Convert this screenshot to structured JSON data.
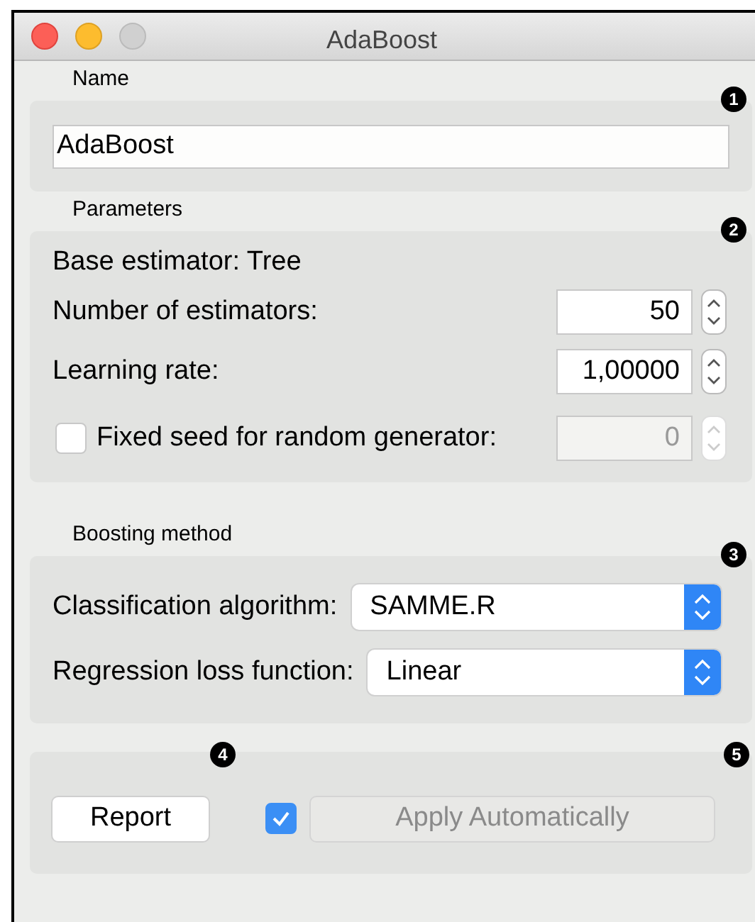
{
  "window": {
    "title": "AdaBoost"
  },
  "name_box": {
    "label": "Name",
    "callout": "1",
    "value": "AdaBoost"
  },
  "parameters": {
    "label": "Parameters",
    "callout": "2",
    "base_estimator": "Base estimator: Tree",
    "spin_fields": [
      {
        "label": "Number of estimators:",
        "value": "50"
      },
      {
        "label": "Learning rate:",
        "value": "1,00000"
      }
    ],
    "fixed_seed": {
      "label": "Fixed seed for random generator:",
      "checked": false,
      "value": "0"
    }
  },
  "boosting": {
    "label": "Boosting method",
    "callout": "3",
    "selects": [
      {
        "label": "Classification algorithm:",
        "value": "SAMME.R"
      },
      {
        "label": "Regression loss function:",
        "value": "Linear"
      }
    ]
  },
  "footer": {
    "callouts": [
      "4",
      "5"
    ],
    "report": "Report",
    "apply": {
      "label": "Apply Automatically",
      "checked": true,
      "disabled": true
    }
  }
}
